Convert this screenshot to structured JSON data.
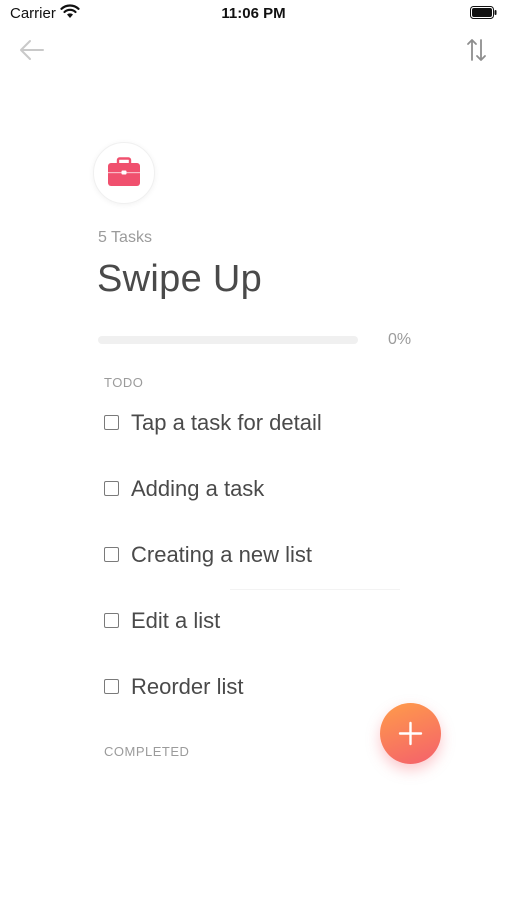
{
  "status_bar": {
    "carrier": "Carrier",
    "time": "11:06 PM"
  },
  "nav": {
    "back_icon": "back-arrow-icon",
    "sort_icon": "sort-icon"
  },
  "list": {
    "icon": "briefcase-icon",
    "task_count": "5 Tasks",
    "title": "Swipe Up",
    "progress": 0,
    "progress_label": "0%"
  },
  "sections": {
    "todo": "TODO",
    "completed": "COMPLETED"
  },
  "tasks": [
    {
      "label": "Tap a task for detail",
      "done": false
    },
    {
      "label": "Adding a task",
      "done": false
    },
    {
      "label": "Creating a new list",
      "done": false
    },
    {
      "label": "Edit a list",
      "done": false
    },
    {
      "label": "Reorder list",
      "done": false
    }
  ],
  "fab": {
    "icon": "plus-icon"
  },
  "colors": {
    "accent": "#f4606c",
    "accent_gradient_start": "#ff9c4a",
    "icon_red": "#f0506e"
  }
}
